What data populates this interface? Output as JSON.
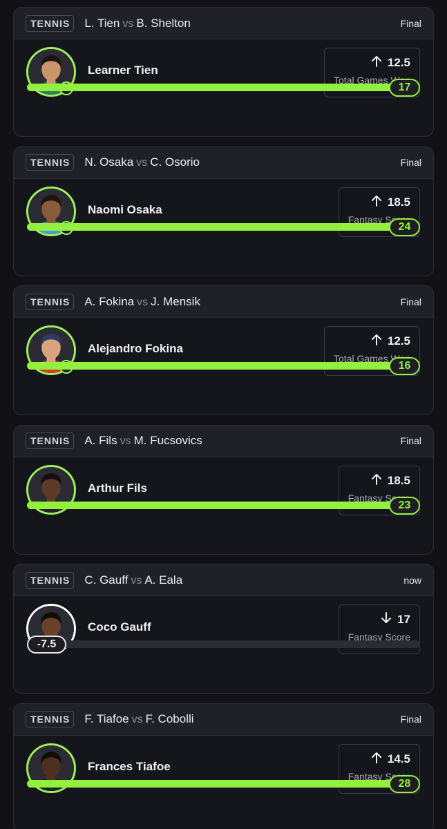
{
  "theme": {
    "accent": "#94f03e",
    "background": "#111116",
    "card": "#15151c"
  },
  "icons": {
    "up": "arrow-up-icon",
    "down": "arrow-down-icon",
    "check": "check-circle-icon"
  },
  "cards": [
    {
      "sport": "TENNIS",
      "player1": "L. Tien",
      "vs": "vs",
      "player2": "B. Shelton",
      "status": "Final",
      "name": "Learner Tien",
      "direction": "up",
      "line": "12.5",
      "stat": "Total Games Won",
      "result": "17",
      "progress": 1.0,
      "skin": "#c9956b",
      "hair": "#1a1410",
      "shirt": "#2e7d6b",
      "ring": "green",
      "checked": true
    },
    {
      "sport": "TENNIS",
      "player1": "N. Osaka",
      "vs": "vs",
      "player2": "C. Osorio",
      "status": "Final",
      "name": "Naomi Osaka",
      "direction": "up",
      "line": "18.5",
      "stat": "Fantasy Score",
      "result": "24",
      "progress": 1.0,
      "skin": "#8a5a3c",
      "hair": "#1f140e",
      "shirt": "#4a9ad6",
      "ring": "green",
      "checked": true
    },
    {
      "sport": "TENNIS",
      "player1": "A. Fokina",
      "vs": "vs",
      "player2": "J. Mensik",
      "status": "Final",
      "name": "Alejandro Fokina",
      "direction": "up",
      "line": "12.5",
      "stat": "Total Games Won",
      "result": "16",
      "progress": 1.0,
      "skin": "#d9a37c",
      "hair": "#2c3a66",
      "shirt": "#d93b2b",
      "ring": "green",
      "checked": true
    },
    {
      "sport": "TENNIS",
      "player1": "A. Fils",
      "vs": "vs",
      "player2": "M. Fucsovics",
      "status": "Final",
      "name": "Arthur Fils",
      "direction": "up",
      "line": "18.5",
      "stat": "Fantasy Score",
      "result": "23",
      "progress": 1.0,
      "skin": "#5e3b26",
      "hair": "#151010",
      "shirt": "#1f1f24",
      "ring": "green",
      "checked": false
    },
    {
      "sport": "TENNIS",
      "player1": "C. Gauff",
      "vs": "vs",
      "player2": "A. Eala",
      "status": "now",
      "name": "Coco Gauff",
      "direction": "down",
      "line": "17",
      "stat": "Fantasy Score",
      "result": "-7.5",
      "progress": 0.0,
      "skin": "#6b4028",
      "hair": "#120c08",
      "shirt": "#f4f4f4",
      "ring": "white",
      "checked": false
    },
    {
      "sport": "TENNIS",
      "player1": "F. Tiafoe",
      "vs": "vs",
      "player2": "F. Cobolli",
      "status": "Final",
      "name": "Frances Tiafoe",
      "direction": "up",
      "line": "14.5",
      "stat": "Fantasy Score",
      "result": "28",
      "progress": 1.0,
      "skin": "#4e3020",
      "hair": "#120c08",
      "shirt": "#1f1f24",
      "ring": "green",
      "checked": false
    }
  ]
}
